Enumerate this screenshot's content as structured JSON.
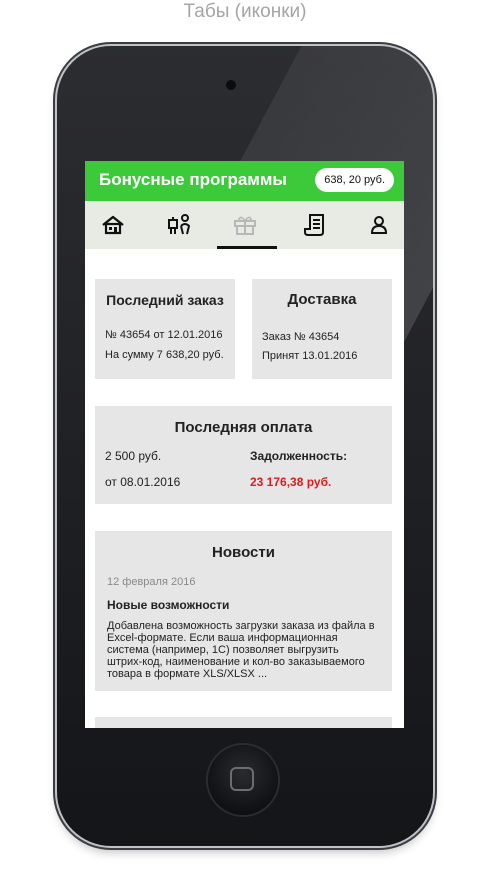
{
  "caption": "Табы (иконки)",
  "header": {
    "title": "Бонусные программы",
    "balance": "638, 20 руб."
  },
  "tabs": [
    {
      "icon": "home-icon",
      "active": false
    },
    {
      "icon": "person-delivery-icon",
      "active": false
    },
    {
      "icon": "gift-icon",
      "active": true
    },
    {
      "icon": "receipt-icon",
      "active": false
    },
    {
      "icon": "user-icon",
      "active": false
    }
  ],
  "last_order": {
    "title": "Последний заказ",
    "line1": "№ 43654 от 12.01.2016",
    "line2": "На сумму 7 638,20 руб."
  },
  "delivery": {
    "title": "Доставка",
    "line1": "Заказ № 43654",
    "line2": "Принят 13.01.2016"
  },
  "last_payment": {
    "title": "Последняя оплата",
    "amount": "2 500 руб.",
    "date": "от 08.01.2016",
    "debt_label": "Задолженность:",
    "debt_value": "23 176,38 руб."
  },
  "news": {
    "title": "Новости",
    "date": "12 февраля 2016",
    "headline": "Новые возможности",
    "body": "Добавлена возможность загрузки заказа из файла в Excel-формате. Если ваша информационная система (например, 1С) позволяет выгрузить штрих-код, наименование и кол-во заказываемого товара в формате XLS/XLSX ..."
  },
  "colors": {
    "accent": "#3cc93a",
    "debt": "#e01b1b",
    "card": "#e6e6e6",
    "tabbar": "#e8ebe4"
  }
}
